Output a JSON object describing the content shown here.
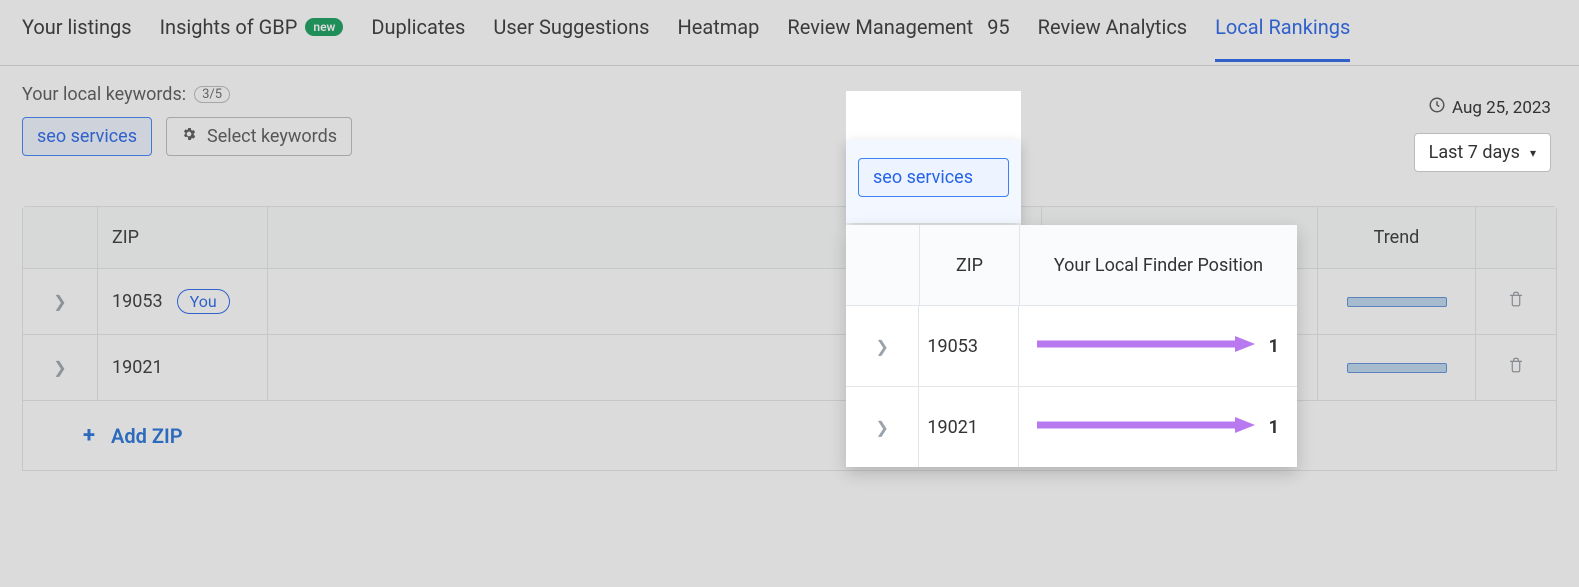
{
  "tabs": {
    "listings": "Your listings",
    "insights": "Insights of GBP",
    "new_badge": "new",
    "duplicates": "Duplicates",
    "suggestions": "User Suggestions",
    "heatmap": "Heatmap",
    "reviews_mgmt": "Review Management",
    "reviews_mgmt_count": "95",
    "reviews_analytics": "Review Analytics",
    "local_rankings": "Local Rankings"
  },
  "keywords": {
    "label": "Your local keywords:",
    "counter": "3/5",
    "chip_main": "seo services",
    "select_label": "Select keywords",
    "chip_highlight": "seo services"
  },
  "date": {
    "current": "Aug 25, 2023",
    "range": "Last 7 days"
  },
  "table": {
    "headers": {
      "zip": "ZIP",
      "position": "Your Local Finder Position",
      "trend": "Trend"
    },
    "rows": [
      {
        "zip": "19053",
        "you": "You",
        "position": "1"
      },
      {
        "zip": "19021",
        "you": "",
        "position": "1"
      }
    ],
    "add_zip": "Add ZIP"
  },
  "hl": {
    "zip_header": "ZIP",
    "pos_header": "Your Local Finder Position",
    "rows": [
      {
        "zip": "19053",
        "position": "1"
      },
      {
        "zip": "19021",
        "position": "1"
      }
    ]
  }
}
